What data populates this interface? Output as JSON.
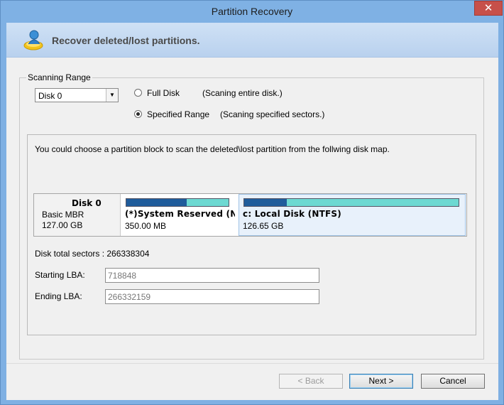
{
  "window": {
    "title": "Partition Recovery",
    "close_glyph": "✕"
  },
  "header": {
    "title": "Recover deleted/lost partitions.",
    "icon": "disk-recovery-icon"
  },
  "scanning_range": {
    "legend": "Scanning Range",
    "disk_select": {
      "value": "Disk 0"
    },
    "options": [
      {
        "label": "Full Disk",
        "desc": "(Scaning entire disk.)",
        "checked": false
      },
      {
        "label": "Specified Range",
        "desc": "(Scaning specified sectors.)",
        "checked": true
      }
    ]
  },
  "disk_map": {
    "instruction": "You could choose a partition block to scan the deleted\\lost partition from the follwing disk map.",
    "disk": {
      "name": "Disk 0",
      "type": "Basic MBR",
      "size": "127.00 GB"
    },
    "partitions": [
      {
        "name": "(*)System Reserved (NTFS)",
        "size": "350.00 MB",
        "used_fraction": 0.59,
        "selected": false
      },
      {
        "name": "c: Local Disk (NTFS)",
        "size": "126.65 GB",
        "used_fraction": 0.2,
        "selected": true
      }
    ]
  },
  "sectors": {
    "total_label": "Disk total sectors : 266338304",
    "starting_lba_label": "Starting LBA:",
    "starting_lba_value": "718848",
    "ending_lba_label": "Ending LBA:",
    "ending_lba_value": "266332159"
  },
  "buttons": {
    "back": "< Back",
    "next": "Next >",
    "cancel": "Cancel"
  },
  "colors": {
    "accent": "#1f5c9b",
    "free_space": "#6dd9d2",
    "titlebar": "#7fb1e4"
  }
}
